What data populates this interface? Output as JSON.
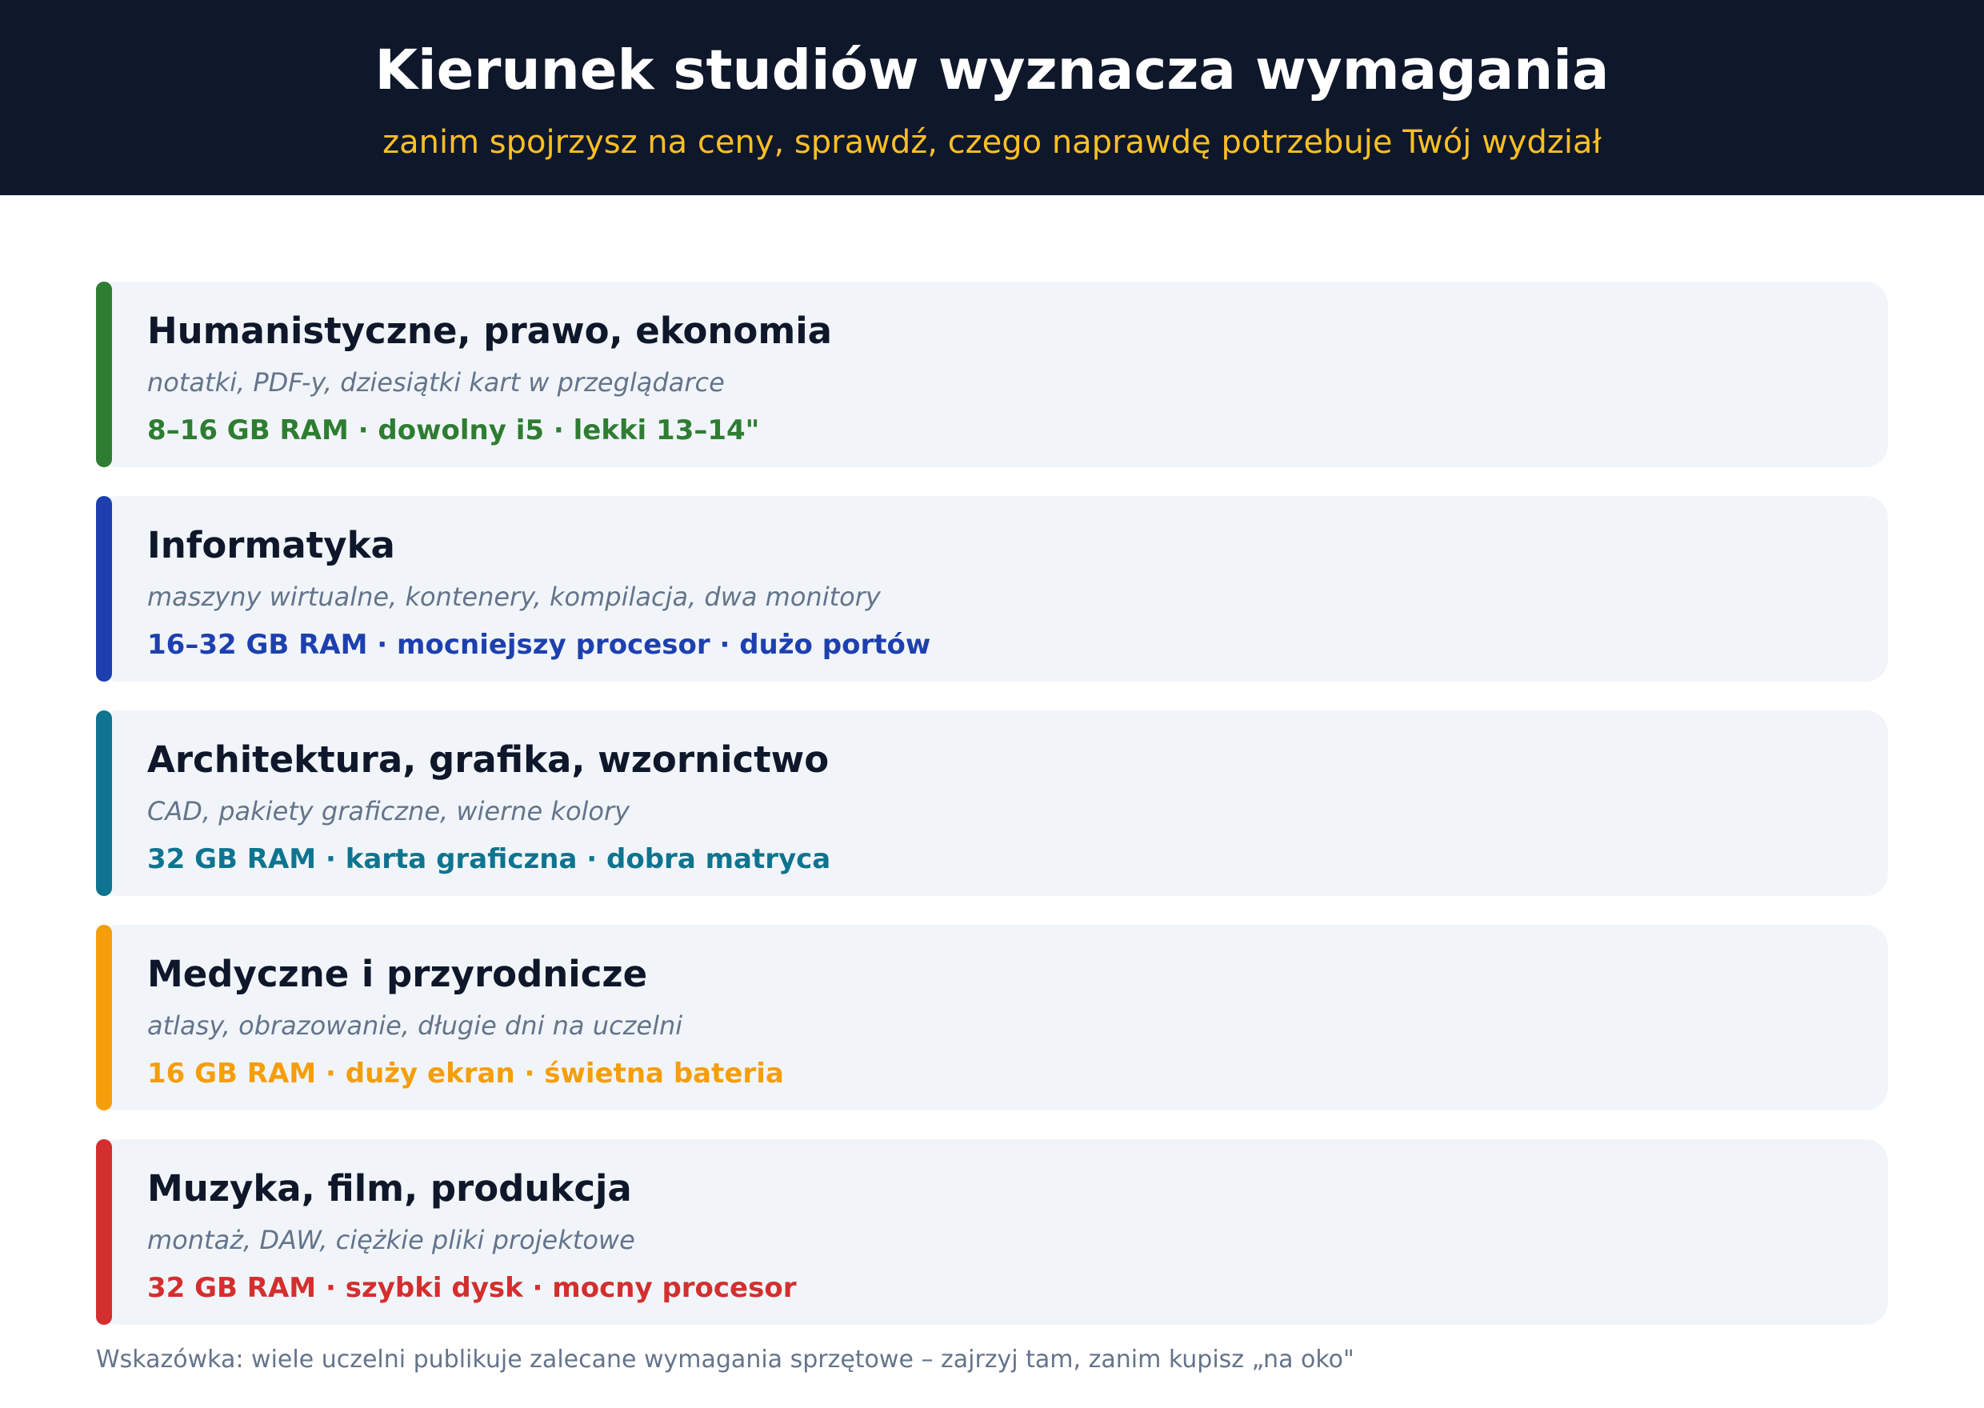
{
  "header": {
    "title": "Kierunek studiów wyznacza wymagania",
    "subtitle": "zanim spojrzysz na ceny, sprawdź, czego naprawdę potrzebuje Twój wydział"
  },
  "cards": [
    {
      "title": "Humanistyczne, prawo, ekonomia",
      "description": "notatki, PDF-y, dziesiątki kart w przeglądarce",
      "specs": "8–16 GB RAM · dowolny i5 · lekki 13–14\"",
      "color": "#2e7d32"
    },
    {
      "title": "Informatyka",
      "description": "maszyny wirtualne, kontenery, kompilacja, dwa monitory",
      "specs": "16–32 GB RAM · mocniejszy procesor · dużo portów",
      "color": "#1e40af"
    },
    {
      "title": "Architektura, grafika, wzornictwo",
      "description": "CAD, pakiety graficzne, wierne kolory",
      "specs": "32 GB RAM · karta graficzna · dobra matryca",
      "color": "#0e7490"
    },
    {
      "title": "Medyczne i przyrodnicze",
      "description": "atlasy, obrazowanie, długie dni na uczelni",
      "specs": "16 GB RAM · duży ekran · świetna bateria",
      "color": "#f59e0b"
    },
    {
      "title": "Muzyka, film, produkcja",
      "description": "montaż, DAW, ciężkie pliki projektowe",
      "specs": "32 GB RAM · szybki dysk · mocny procesor",
      "color": "#d32f2f"
    }
  ],
  "footer": {
    "tip": "Wskazówka: wiele uczelni publikuje zalecane wymagania sprzętowe – zajrzyj tam, zanim kupisz „na oko\""
  }
}
